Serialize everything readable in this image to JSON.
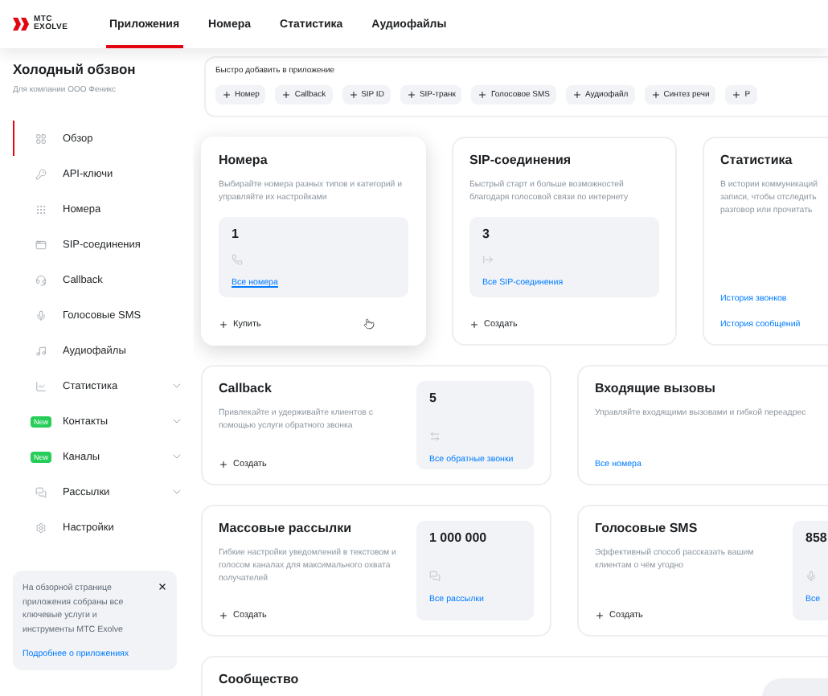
{
  "header": {
    "logo": [
      "МТС",
      "EXOLVE"
    ],
    "tabs": [
      {
        "label": "Приложения",
        "selected": true
      },
      {
        "label": "Номера",
        "selected": false
      },
      {
        "label": "Статистика",
        "selected": false
      },
      {
        "label": "Аудиофайлы",
        "selected": false
      }
    ]
  },
  "sidebar": {
    "title": "Холодный обзвон",
    "subtitle": "Для компании ООО Феникс",
    "items": [
      {
        "label": "Обзор",
        "selected": true,
        "expandable": false
      },
      {
        "label": "API-ключи",
        "selected": false,
        "expandable": false
      },
      {
        "label": "Номера",
        "selected": false,
        "expandable": false
      },
      {
        "label": "SIP-соединения",
        "selected": false,
        "expandable": false
      },
      {
        "label": "Callback",
        "selected": false,
        "expandable": false
      },
      {
        "label": "Голосовые SMS",
        "selected": false,
        "expandable": false
      },
      {
        "label": "Аудиофайлы",
        "selected": false,
        "expandable": false
      },
      {
        "label": "Статистика",
        "selected": false,
        "expandable": true
      },
      {
        "label": "Контакты",
        "badge": "New",
        "selected": false,
        "expandable": true
      },
      {
        "label": "Каналы",
        "badge": "New",
        "selected": false,
        "expandable": true
      },
      {
        "label": "Рассылки",
        "selected": false,
        "expandable": true
      },
      {
        "label": "Настройки",
        "selected": false,
        "expandable": false
      }
    ],
    "info": {
      "text": "На обзорной странице приложения собраны все ключевые услуги и инструменты МТС Exolve",
      "link": "Подробнее о приложениях"
    }
  },
  "quick_add": {
    "title": "Быстро добавить в приложение",
    "chips": [
      "Номер",
      "Callback",
      "SIP ID",
      "SIP-транк",
      "Голосовое SMS",
      "Аудиофайл",
      "Синтез речи",
      "Р"
    ]
  },
  "card_rows": [
    [
      {
        "kind": "stacked",
        "title": "Номера",
        "description": "Выбирайте номера разных типов и категорий и управляйте их настройками",
        "hovered": true,
        "tile": {
          "count": "1",
          "link": "Все номера"
        },
        "action": "Купить"
      },
      {
        "kind": "stacked",
        "title": "SIP-соединения",
        "description": "Быстрый старт и больше возможностей благодаря голосовой связи по интернету",
        "hovered": false,
        "tile": {
          "count": "3",
          "link": "Все SIP-соединения"
        },
        "action": "Создать"
      },
      {
        "kind": "stacked",
        "title": "Статистика",
        "description_lines": [
          "В истории коммуникаций",
          "записи, чтобы отследить",
          "разговор или прочитать"
        ],
        "hovered": false,
        "links": [
          "История звонков",
          "История сообщений"
        ]
      }
    ],
    [
      {
        "kind": "side",
        "title": "Callback",
        "description": "Привлекайте и удерживайте клиентов с помощью услуги обратного звонка",
        "hovered": false,
        "tile": {
          "count": "5",
          "link": "Все обратные звонки"
        },
        "action": "Создать"
      },
      {
        "kind": "side",
        "title": "Входящие вызовы",
        "description_lines": [
          "Управляйте входящими вызовами и гибкой переадрес"
        ],
        "hovered": false,
        "links": [
          "Все номера"
        ]
      }
    ],
    [
      {
        "kind": "side",
        "title": "Массовые рассылки",
        "description": "Гибкие настройки уведомлений в текстовом и голосом каналах для максимального охвата получателей",
        "hovered": false,
        "tile": {
          "count": "1 000 000",
          "link": "Все рассылки"
        },
        "action": "Создать"
      },
      {
        "kind": "side",
        "title": "Голосовые SMS",
        "description": "Эффективный способ рассказать вашим клиентам о чём угодно",
        "hovered": false,
        "tile": {
          "count": "858",
          "link": "Все"
        },
        "action": "Создать"
      }
    ]
  ],
  "community": {
    "title": "Сообщество"
  }
}
